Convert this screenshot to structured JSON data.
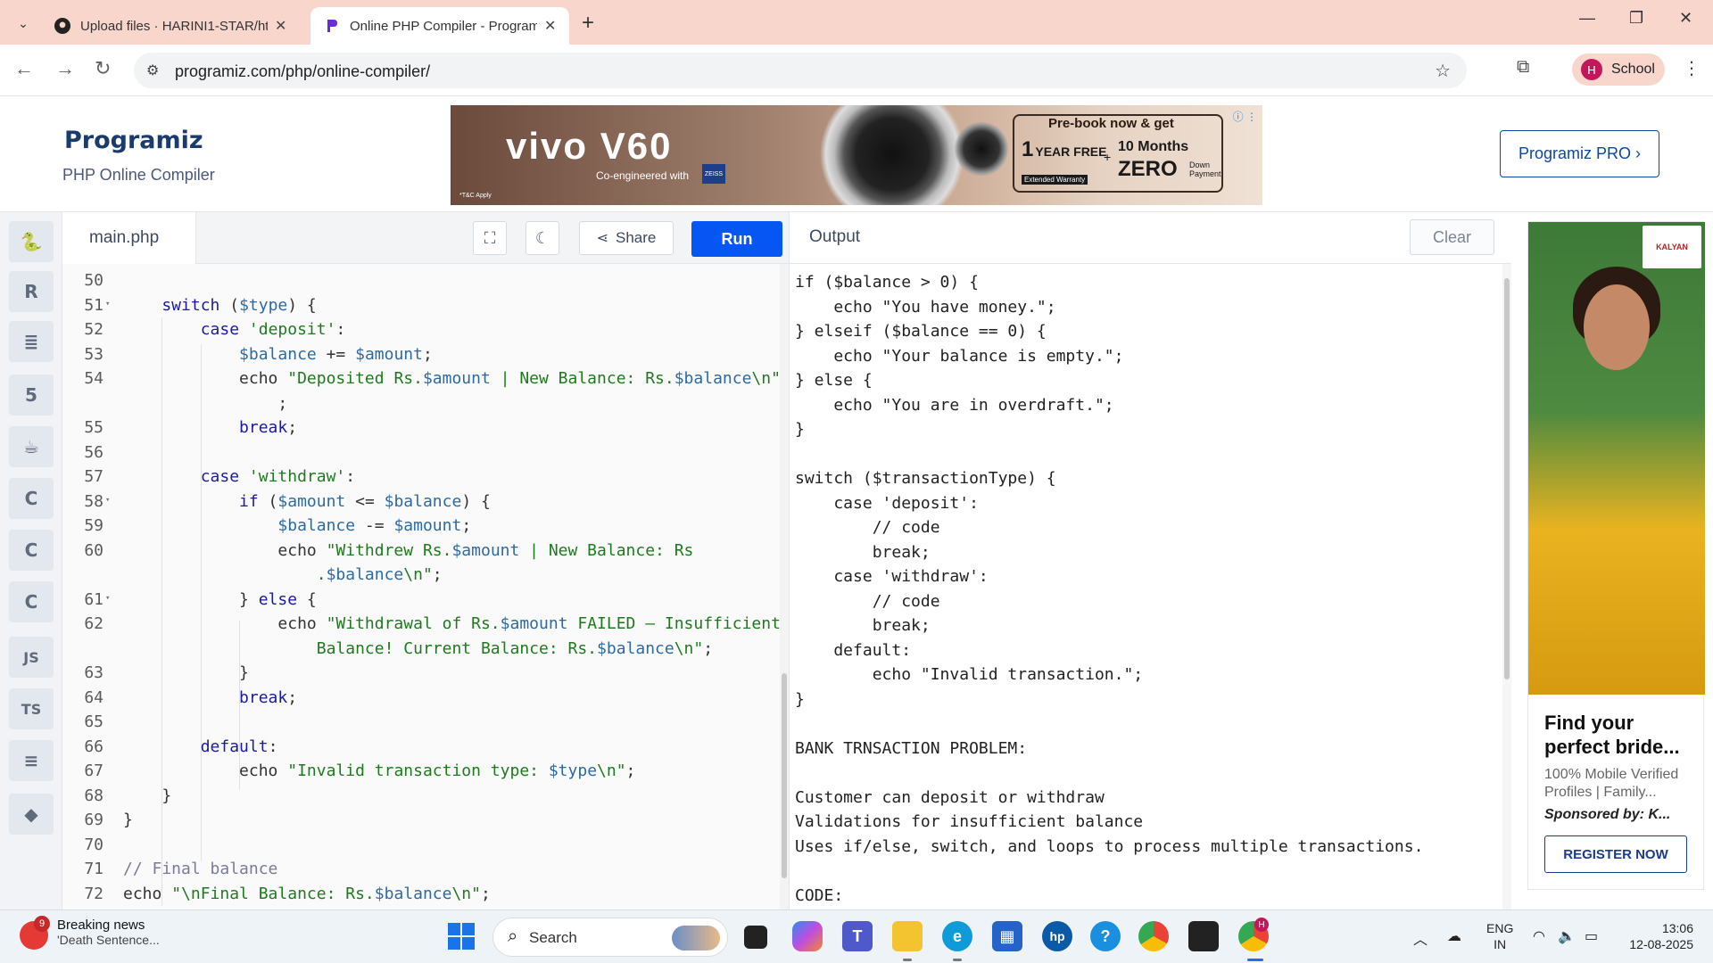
{
  "browser": {
    "tabs": [
      {
        "title": "Upload files · HARINI1-STAR/htm",
        "active": false
      },
      {
        "title": "Online PHP Compiler - Programiz",
        "active": true
      }
    ],
    "url": "programiz.com/php/online-compiler/",
    "profile_initial": "H",
    "profile_name": "School"
  },
  "site": {
    "logo": "Programiz",
    "subtitle": "PHP Online Compiler",
    "pro_button": "Programiz PRO ›"
  },
  "top_ad": {
    "brand": "vivo V60",
    "tagline": "Co-engineered with",
    "partner": "ZEISS",
    "tnc": "*T&C Apply",
    "prebook": "Pre-book now & get",
    "free_num": "1",
    "free_label": "YEAR FREE",
    "warranty": "Extended Warranty",
    "plus": "+",
    "months": "10 Months",
    "zero": "ZERO",
    "down": "Down Payment"
  },
  "rail": {
    "items": [
      {
        "name": "python-icon",
        "glyph": "🐍"
      },
      {
        "name": "r-icon",
        "glyph": "R"
      },
      {
        "name": "sql-icon",
        "glyph": "≣"
      },
      {
        "name": "html-icon",
        "glyph": "5"
      },
      {
        "name": "java-icon",
        "glyph": "☕"
      },
      {
        "name": "c-icon",
        "glyph": "C"
      },
      {
        "name": "cpp-icon",
        "glyph": "C"
      },
      {
        "name": "csharp-icon",
        "glyph": "C"
      },
      {
        "name": "js-icon",
        "glyph": "JS"
      },
      {
        "name": "ts-icon",
        "glyph": "TS"
      },
      {
        "name": "go-icon",
        "glyph": "≡"
      },
      {
        "name": "swift-icon",
        "glyph": "◆"
      }
    ]
  },
  "editor": {
    "filename": "main.php",
    "share_label": "Share",
    "run_label": "Run",
    "lines": [
      {
        "n": "50",
        "fold": false,
        "tokens": []
      },
      {
        "n": "51",
        "fold": true,
        "tokens": [
          [
            "kw",
            "    switch"
          ],
          [
            "p",
            " ("
          ],
          [
            "var",
            "$type"
          ],
          [
            "p",
            ") {"
          ]
        ]
      },
      {
        "n": "52",
        "fold": false,
        "tokens": [
          [
            "kw",
            "        case"
          ],
          [
            "p",
            " "
          ],
          [
            "str",
            "'deposit'"
          ],
          [
            "p",
            ":"
          ]
        ]
      },
      {
        "n": "53",
        "fold": false,
        "tokens": [
          [
            "var",
            "            $balance"
          ],
          [
            "p",
            " += "
          ],
          [
            "var",
            "$amount"
          ],
          [
            "p",
            ";"
          ]
        ]
      },
      {
        "n": "54",
        "fold": false,
        "tokens": [
          [
            "p",
            "            echo "
          ],
          [
            "str",
            "\"Deposited Rs."
          ],
          [
            "var",
            "$amount"
          ],
          [
            "str",
            " | New Balance: Rs."
          ],
          [
            "var",
            "$balance"
          ],
          [
            "str",
            "\\n\""
          ]
        ]
      },
      {
        "n": "",
        "fold": false,
        "tokens": [
          [
            "p",
            "                ;"
          ]
        ]
      },
      {
        "n": "55",
        "fold": false,
        "tokens": [
          [
            "kw",
            "            break"
          ],
          [
            "p",
            ";"
          ]
        ]
      },
      {
        "n": "56",
        "fold": false,
        "tokens": []
      },
      {
        "n": "57",
        "fold": false,
        "tokens": [
          [
            "kw",
            "        case"
          ],
          [
            "p",
            " "
          ],
          [
            "str",
            "'withdraw'"
          ],
          [
            "p",
            ":"
          ]
        ]
      },
      {
        "n": "58",
        "fold": true,
        "tokens": [
          [
            "kw",
            "            if"
          ],
          [
            "p",
            " ("
          ],
          [
            "var",
            "$amount"
          ],
          [
            "p",
            " <= "
          ],
          [
            "var",
            "$balance"
          ],
          [
            "p",
            ") {"
          ]
        ]
      },
      {
        "n": "59",
        "fold": false,
        "tokens": [
          [
            "var",
            "                $balance"
          ],
          [
            "p",
            " -= "
          ],
          [
            "var",
            "$amount"
          ],
          [
            "p",
            ";"
          ]
        ]
      },
      {
        "n": "60",
        "fold": false,
        "tokens": [
          [
            "p",
            "                echo "
          ],
          [
            "str",
            "\"Withdrew Rs."
          ],
          [
            "var",
            "$amount"
          ],
          [
            "str",
            " | New Balance: Rs"
          ]
        ]
      },
      {
        "n": "",
        "fold": false,
        "tokens": [
          [
            "str",
            "                    ."
          ],
          [
            "var",
            "$balance"
          ],
          [
            "str",
            "\\n\""
          ],
          [
            "p",
            ";"
          ]
        ]
      },
      {
        "n": "61",
        "fold": true,
        "tokens": [
          [
            "p",
            "            } "
          ],
          [
            "kw",
            "else"
          ],
          [
            "p",
            " {"
          ]
        ]
      },
      {
        "n": "62",
        "fold": false,
        "tokens": [
          [
            "p",
            "                echo "
          ],
          [
            "str",
            "\"Withdrawal of Rs."
          ],
          [
            "var",
            "$amount"
          ],
          [
            "str",
            " FAILED – Insufficient"
          ]
        ]
      },
      {
        "n": "",
        "fold": false,
        "tokens": [
          [
            "str",
            "                    Balance! Current Balance: Rs."
          ],
          [
            "var",
            "$balance"
          ],
          [
            "str",
            "\\n\""
          ],
          [
            "p",
            ";"
          ]
        ]
      },
      {
        "n": "63",
        "fold": false,
        "tokens": [
          [
            "p",
            "            }"
          ]
        ]
      },
      {
        "n": "64",
        "fold": false,
        "tokens": [
          [
            "kw",
            "            break"
          ],
          [
            "p",
            ";"
          ]
        ]
      },
      {
        "n": "65",
        "fold": false,
        "tokens": []
      },
      {
        "n": "66",
        "fold": false,
        "tokens": [
          [
            "kw",
            "        default"
          ],
          [
            "p",
            ":"
          ]
        ]
      },
      {
        "n": "67",
        "fold": false,
        "tokens": [
          [
            "p",
            "            echo "
          ],
          [
            "str",
            "\"Invalid transaction type: "
          ],
          [
            "var",
            "$type"
          ],
          [
            "str",
            "\\n\""
          ],
          [
            "p",
            ";"
          ]
        ]
      },
      {
        "n": "68",
        "fold": false,
        "tokens": [
          [
            "p",
            "    }"
          ]
        ]
      },
      {
        "n": "69",
        "fold": false,
        "tokens": [
          [
            "p",
            "}"
          ]
        ]
      },
      {
        "n": "70",
        "fold": false,
        "tokens": []
      },
      {
        "n": "71",
        "fold": false,
        "tokens": [
          [
            "cm",
            "// Final balance"
          ]
        ]
      },
      {
        "n": "72",
        "fold": false,
        "tokens": [
          [
            "p",
            "echo "
          ],
          [
            "str",
            "\"\\nFinal Balance: Rs."
          ],
          [
            "var",
            "$balance"
          ],
          [
            "str",
            "\\n\""
          ],
          [
            "p",
            ";"
          ]
        ]
      }
    ]
  },
  "output": {
    "title": "Output",
    "clear_label": "Clear",
    "lines": [
      "if ($balance > 0) {",
      "    echo \"You have money.\";",
      "} elseif ($balance == 0) {",
      "    echo \"Your balance is empty.\";",
      "} else {",
      "    echo \"You are in overdraft.\";",
      "}",
      "",
      "switch ($transactionType) {",
      "    case 'deposit':",
      "        // code",
      "        break;",
      "    case 'withdraw':",
      "        // code",
      "        break;",
      "    default:",
      "        echo \"Invalid transaction.\";",
      "}",
      "",
      "BANK TRNSACTION PROBLEM:",
      "",
      "Customer can deposit or withdraw",
      "Validations for insufficient balance",
      "Uses if/else, switch, and loops to process multiple transactions.",
      "",
      "CODE:"
    ]
  },
  "side_ad": {
    "logo_text": "KALYAN",
    "title": "Find your perfect bride...",
    "desc": "100% Mobile Verified Profiles | Family...",
    "sponsor": "Sponsored by: K...",
    "cta": "REGISTER NOW"
  },
  "taskbar": {
    "news_badge": "9",
    "news_title": "Breaking news",
    "news_sub": "'Death Sentence...",
    "search_label": "Search",
    "lang1": "ENG",
    "lang2": "IN",
    "time": "13:06",
    "date": "12-08-2025",
    "chrome_badge": "H"
  }
}
